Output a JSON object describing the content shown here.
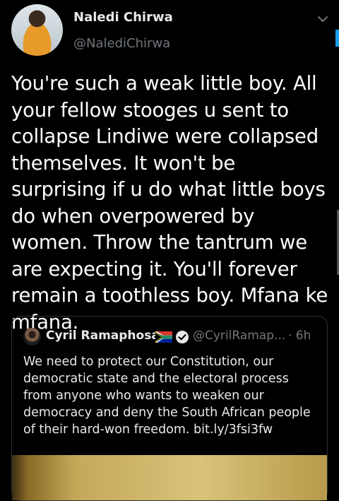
{
  "tweet": {
    "display_name": "Naledi Chirwa",
    "handle": "@NalediChirwa",
    "text": "You're such a weak little boy. All your fellow stooges u sent to collapse Lindiwe were collapsed themselves. It won't be surprising if u do what little boys do when overpowered by women. Throw the tantrum we are expecting it. You'll forever remain a toothless boy. Mfana ke mfana.",
    "menu_icon": "chevron-down-icon"
  },
  "quoted_tweet": {
    "display_name": "Cyril Ramaphosa",
    "flag_icon": "south-africa-flag-icon",
    "verified_icon": "verified-badge-icon",
    "handle": "@CyrilRamap...",
    "time": "· 6h",
    "text": "We need to protect our Constitution, our democratic state and the electoral process from anyone who wants to weaken our democracy and deny the South African people of their hard-won freedom. bit.ly/3fsi3fw"
  },
  "colors": {
    "background": "#000000",
    "text": "#ffffff",
    "secondary_text": "#71767b",
    "border": "#2f3336",
    "accent": "#1d9bf0"
  }
}
